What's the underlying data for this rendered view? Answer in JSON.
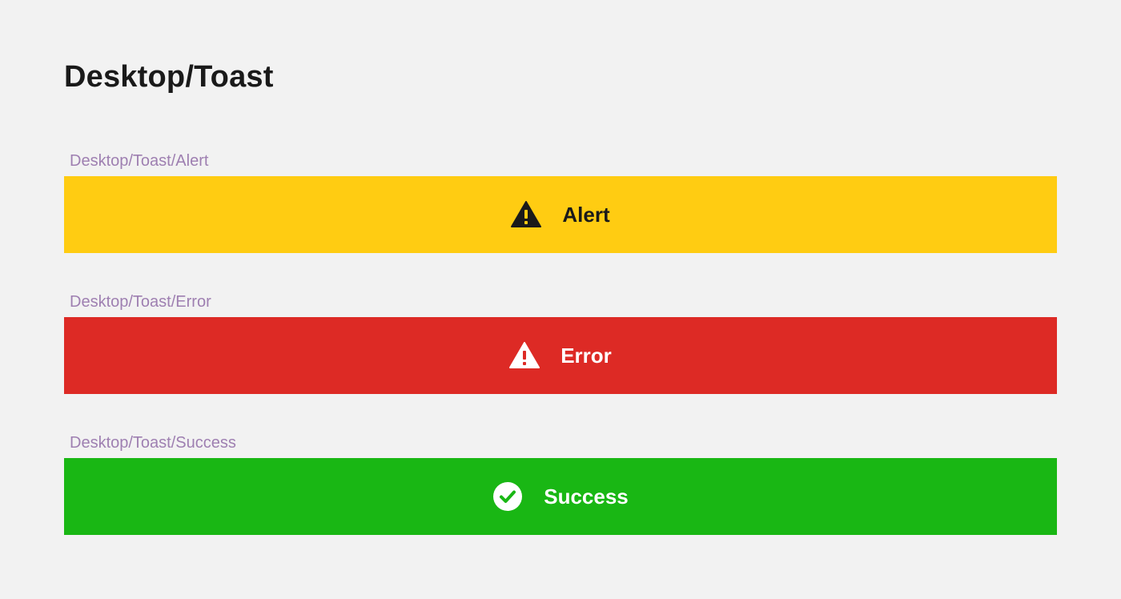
{
  "page": {
    "title": "Desktop/Toast",
    "background": "#f2f2f2"
  },
  "toasts": [
    {
      "frame_label": "Desktop/Toast/Alert",
      "message": "Alert",
      "icon": "warning-triangle-icon",
      "background": "#ffcc12",
      "text_color": "#1a1a1a"
    },
    {
      "frame_label": "Desktop/Toast/Error",
      "message": "Error",
      "icon": "warning-triangle-icon",
      "background": "#dd2a25",
      "text_color": "#ffffff"
    },
    {
      "frame_label": "Desktop/Toast/Success",
      "message": "Success",
      "icon": "check-circle-icon",
      "background": "#19b714",
      "text_color": "#ffffff"
    }
  ]
}
